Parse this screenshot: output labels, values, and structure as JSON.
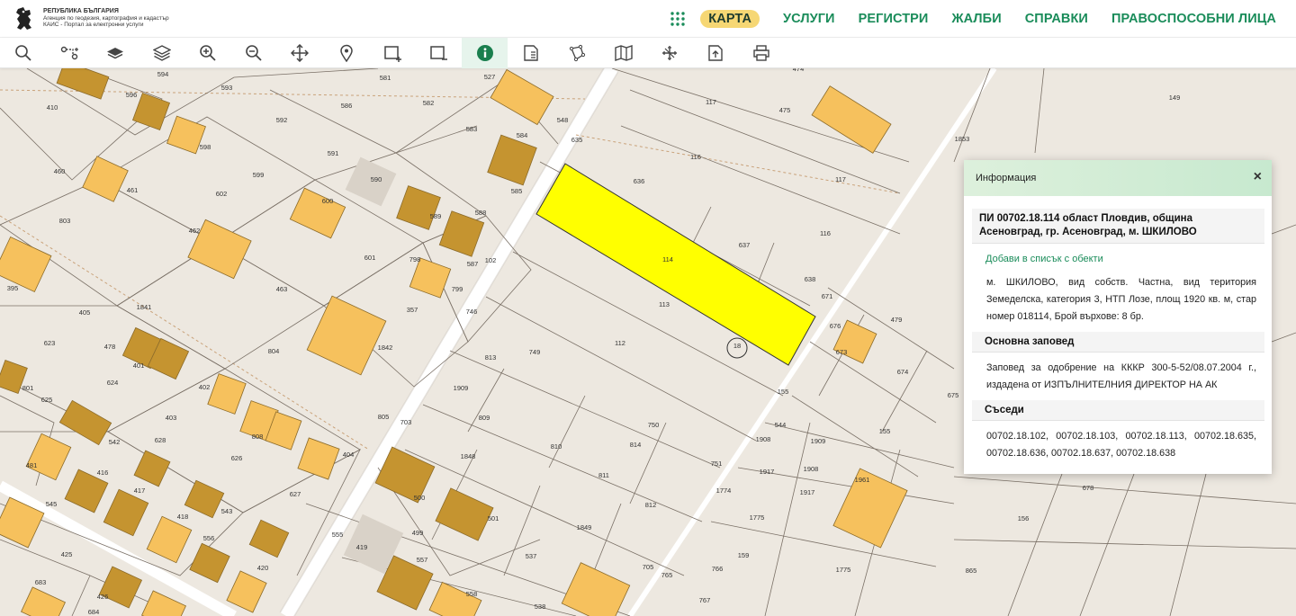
{
  "header": {
    "logo_line1": "РЕПУБЛИКА БЪЛГАРИЯ",
    "logo_line2": "Агенция по геодезия, картография и кадастър",
    "logo_line3": "КАИС - Портал за електронни услуги",
    "nav": [
      "КАРТА",
      "УСЛУГИ",
      "РЕГИСТРИ",
      "ЖАЛБИ",
      "СПРАВКИ",
      "ПРАВОСПОСОБНИ ЛИЦА"
    ]
  },
  "toolbar": {
    "tools": [
      "search-icon",
      "route-icon",
      "layers-solid-icon",
      "layers-outline-icon",
      "zoom-in-icon",
      "zoom-out-icon",
      "pan-icon",
      "location-pin-icon",
      "select-rectangle-icon",
      "deselect-rectangle-icon",
      "info-icon",
      "document-icon",
      "polygon-icon",
      "map-icon",
      "measure-icon",
      "export-icon",
      "print-icon"
    ],
    "active": "info-icon"
  },
  "info": {
    "header": "Информация",
    "close": "×",
    "title": "ПИ 00702.18.114 област Пловдив, община Асеновград, гр. Асеновград, м. ШКИЛОВО",
    "add_link": "Добави в списък с обекти",
    "description": "м. ШКИЛОВО, вид собств. Частна, вид територия Земеделска, категория 3, НТП Лозе, площ 1920 кв. м, стар номер 018114, Брой върхове: 8 бр.",
    "order_heading": "Основна заповед",
    "order_text": "Заповед за одобрение на КККР 300-5-52/08.07.2004 г., издадена от ИЗПЪЛНИТЕЛНИЯ ДИРЕКТОР НА АК",
    "neighbors_heading": "Съседи",
    "neighbors_text": "00702.18.102, 00702.18.103, 00702.18.113, 00702.18.635, 00702.18.636, 00702.18.637, 00702.18.638"
  },
  "map": {
    "highlight_color": "#ffff00",
    "building_color_light": "#f6c15d",
    "building_color_dark": "#c59430",
    "parcel_labels": [
      "410",
      "596",
      "594",
      "593",
      "581",
      "586",
      "527",
      "582",
      "583",
      "548",
      "584",
      "117",
      "474",
      "475",
      "149",
      "598",
      "592",
      "635",
      "585",
      "116",
      "1853",
      "460",
      "461",
      "602",
      "599",
      "591",
      "590",
      "600",
      "589",
      "588",
      "636",
      "117",
      "803",
      "462",
      "601",
      "798",
      "587",
      "102",
      "637",
      "116",
      "395",
      "463",
      "357",
      "799",
      "746",
      "114",
      "638",
      "671",
      "479",
      "405",
      "1841",
      "113",
      "676",
      "401",
      "673",
      "674",
      "623",
      "478",
      "804",
      "1842",
      "813",
      "749",
      "112",
      "18",
      "155",
      "675",
      "801",
      "624",
      "402",
      "808",
      "1909",
      "544",
      "625",
      "403",
      "805",
      "703",
      "809",
      "1908",
      "1909",
      "155",
      "542",
      "628",
      "626",
      "404",
      "810",
      "814",
      "750",
      "1848",
      "751",
      "1917",
      "1908",
      "1961",
      "481",
      "416",
      "627",
      "811",
      "1774",
      "417",
      "545",
      "500",
      "1917",
      "543",
      "418",
      "812",
      "678",
      "501",
      "1775",
      "556",
      "419",
      "499",
      "425",
      "555",
      "1849",
      "159",
      "156",
      "420",
      "557",
      "537",
      "705",
      "765",
      "766",
      "1775",
      "865",
      "683",
      "426",
      "684",
      "558",
      "538",
      "767"
    ]
  }
}
